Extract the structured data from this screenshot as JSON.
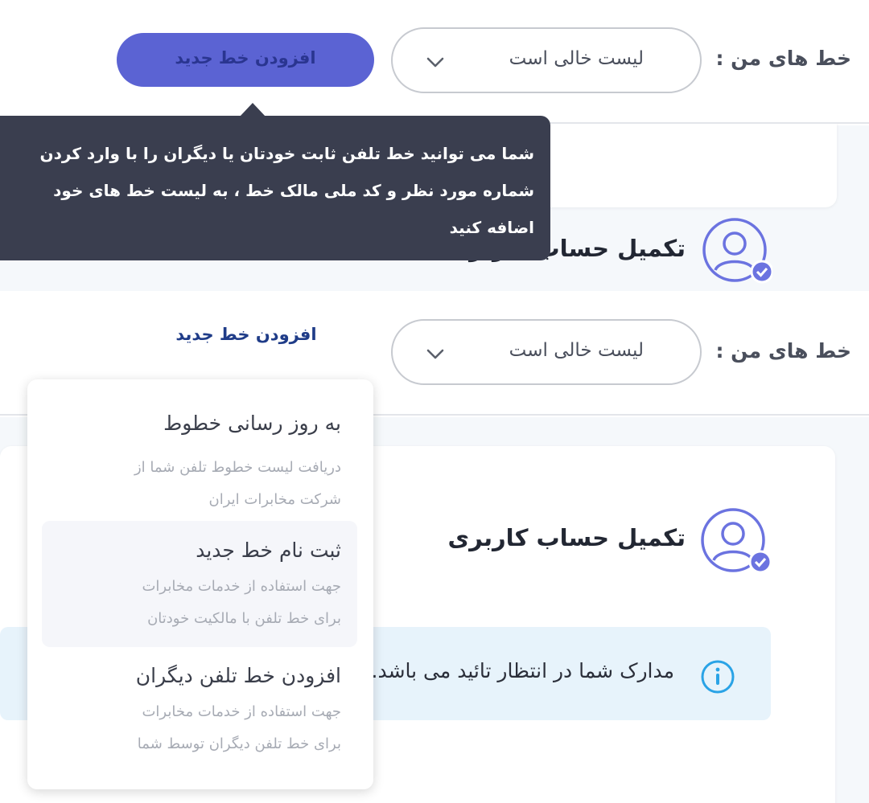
{
  "header": {
    "my_lines_label": "خط های من :",
    "lines_select_value": "لیست خالی است",
    "add_line_label": "افزودن خط جدید"
  },
  "tooltip": {
    "lines": [
      "شما می توانید خط تلفن ثابت خودتان یا دیگران را با وارد کردن",
      "شماره مورد نظر و کد ملی مالک خط ، به لیست خط های خود",
      "اضافه کنید"
    ]
  },
  "profile_card": {
    "title": "تکمیل حساب کاربری",
    "info_message": "مدارک شما در انتظار تائید می باشد. برای"
  },
  "dropdown": {
    "items": [
      {
        "title": "به روز رسانی خطوط",
        "desc_1": "دریافت لیست خطوط تلفن شما از",
        "desc_2": "شرکت مخابرات ایران"
      },
      {
        "title": "ثبت نام خط جدید",
        "desc_1": "جهت استفاده از خدمات مخابرات",
        "desc_2": "برای خط تلفن با مالکیت خودتان"
      },
      {
        "title": "افزودن خط تلفن دیگران",
        "desc_1": "جهت استفاده از خدمات مخابرات",
        "desc_2": "برای خط تلفن دیگران توسط شما"
      }
    ]
  },
  "colors": {
    "accent": "#5b63d3",
    "accent_text": "#2a3590",
    "link": "#1f3c88",
    "tooltip_bg": "#3a3e4f",
    "avatar_stroke": "#6b73e0",
    "info_bg": "#e7f3fb",
    "info_icon": "#2aa3e6"
  },
  "icons": {
    "chevron": "chevron-down-icon",
    "avatar": "user-verified-icon",
    "info": "info-icon"
  }
}
